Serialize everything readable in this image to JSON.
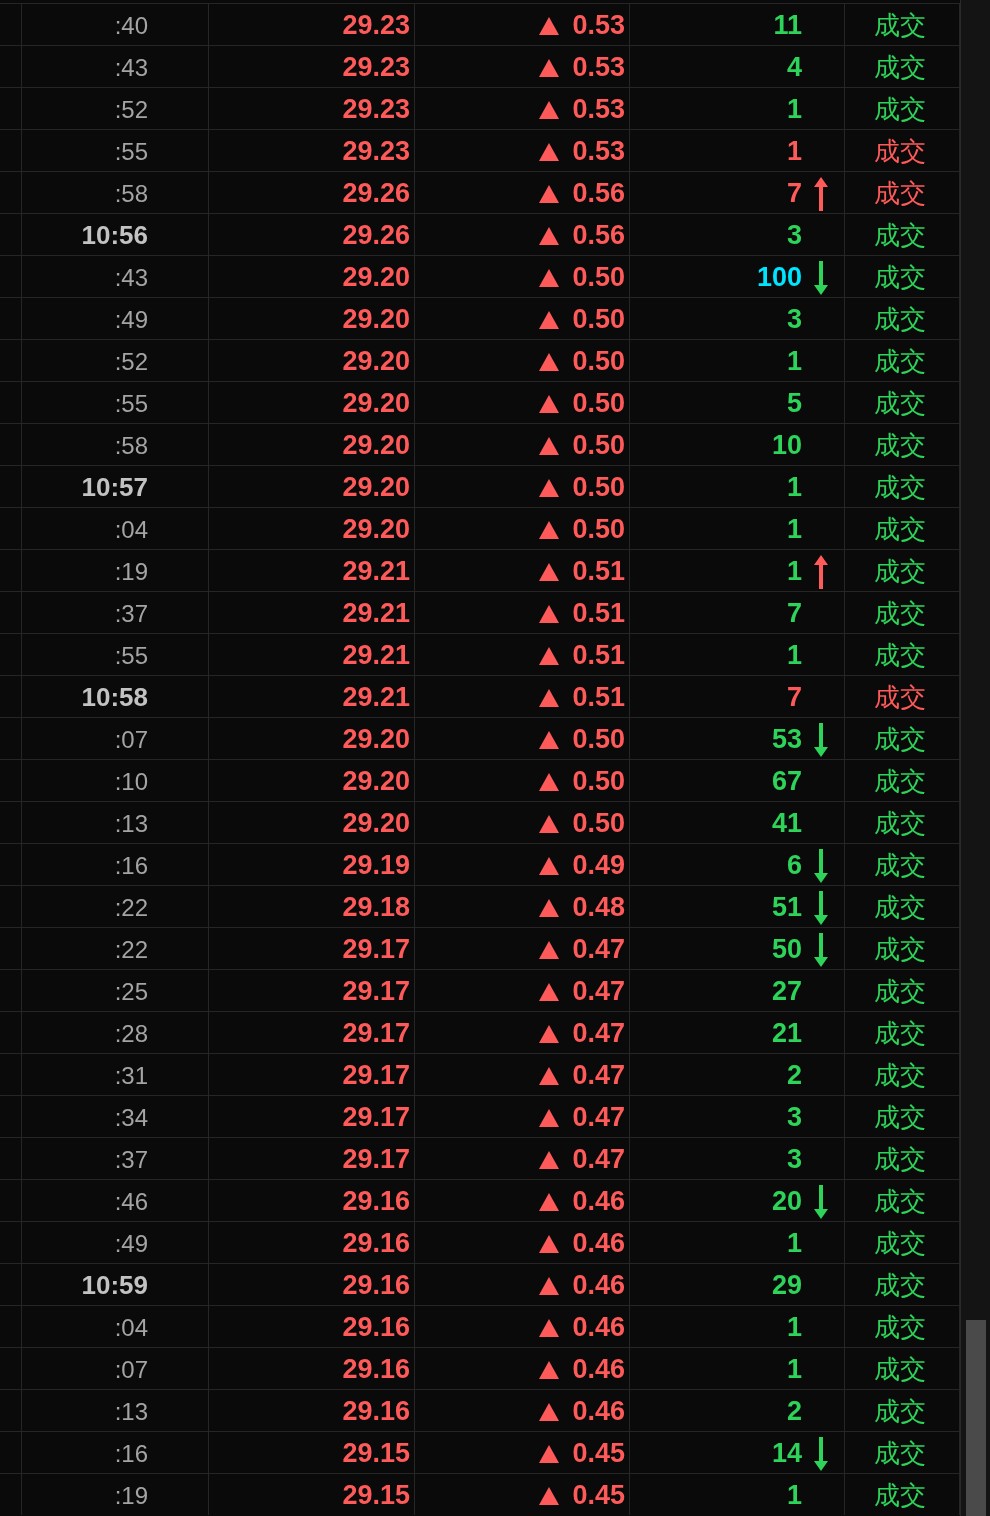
{
  "rows": [
    {
      "time": ":40",
      "bold": false,
      "price": "29.23",
      "change": {
        "text": "0.53",
        "rising": true
      },
      "volume": {
        "text": "11",
        "color": "#2ed35a"
      },
      "status": {
        "text": "成交",
        "color": "#2ed35a"
      }
    },
    {
      "time": ":43",
      "bold": false,
      "price": "29.23",
      "change": {
        "text": "0.53",
        "rising": true
      },
      "volume": {
        "text": "4",
        "color": "#2ed35a"
      },
      "status": {
        "text": "成交",
        "color": "#2ed35a"
      }
    },
    {
      "time": ":52",
      "bold": false,
      "price": "29.23",
      "change": {
        "text": "0.53",
        "rising": true
      },
      "volume": {
        "text": "1",
        "color": "#2ed35a"
      },
      "status": {
        "text": "成交",
        "color": "#2ed35a"
      }
    },
    {
      "time": ":55",
      "bold": false,
      "price": "29.23",
      "change": {
        "text": "0.53",
        "rising": true
      },
      "volume": {
        "text": "1",
        "color": "#ff5a5a"
      },
      "status": {
        "text": "成交",
        "color": "#ff5a5a"
      }
    },
    {
      "time": ":58",
      "bold": false,
      "price": "29.26",
      "change": {
        "text": "0.56",
        "rising": true
      },
      "volume": {
        "text": "7",
        "color": "#ff5a5a"
      },
      "arrow": {
        "kind": "up"
      },
      "status": {
        "text": "成交",
        "color": "#ff5a5a"
      }
    },
    {
      "time": "10:56",
      "bold": true,
      "price": "29.26",
      "change": {
        "text": "0.56",
        "rising": true
      },
      "volume": {
        "text": "3",
        "color": "#2ed35a"
      },
      "status": {
        "text": "成交",
        "color": "#2ed35a"
      }
    },
    {
      "time": ":43",
      "bold": false,
      "price": "29.20",
      "change": {
        "text": "0.50",
        "rising": true
      },
      "volume": {
        "text": "100",
        "color": "#00e5ff"
      },
      "arrow": {
        "kind": "down"
      },
      "status": {
        "text": "成交",
        "color": "#2ed35a"
      }
    },
    {
      "time": ":49",
      "bold": false,
      "price": "29.20",
      "change": {
        "text": "0.50",
        "rising": true
      },
      "volume": {
        "text": "3",
        "color": "#2ed35a"
      },
      "status": {
        "text": "成交",
        "color": "#2ed35a"
      }
    },
    {
      "time": ":52",
      "bold": false,
      "price": "29.20",
      "change": {
        "text": "0.50",
        "rising": true
      },
      "volume": {
        "text": "1",
        "color": "#2ed35a"
      },
      "status": {
        "text": "成交",
        "color": "#2ed35a"
      }
    },
    {
      "time": ":55",
      "bold": false,
      "price": "29.20",
      "change": {
        "text": "0.50",
        "rising": true
      },
      "volume": {
        "text": "5",
        "color": "#2ed35a"
      },
      "status": {
        "text": "成交",
        "color": "#2ed35a"
      }
    },
    {
      "time": ":58",
      "bold": false,
      "price": "29.20",
      "change": {
        "text": "0.50",
        "rising": true
      },
      "volume": {
        "text": "10",
        "color": "#2ed35a"
      },
      "status": {
        "text": "成交",
        "color": "#2ed35a"
      }
    },
    {
      "time": "10:57",
      "bold": true,
      "price": "29.20",
      "change": {
        "text": "0.50",
        "rising": true
      },
      "volume": {
        "text": "1",
        "color": "#2ed35a"
      },
      "status": {
        "text": "成交",
        "color": "#2ed35a"
      }
    },
    {
      "time": ":04",
      "bold": false,
      "price": "29.20",
      "change": {
        "text": "0.50",
        "rising": true
      },
      "volume": {
        "text": "1",
        "color": "#2ed35a"
      },
      "status": {
        "text": "成交",
        "color": "#2ed35a"
      }
    },
    {
      "time": ":19",
      "bold": false,
      "price": "29.21",
      "change": {
        "text": "0.51",
        "rising": true
      },
      "volume": {
        "text": "1",
        "color": "#2ed35a"
      },
      "arrow": {
        "kind": "up"
      },
      "status": {
        "text": "成交",
        "color": "#2ed35a"
      }
    },
    {
      "time": ":37",
      "bold": false,
      "price": "29.21",
      "change": {
        "text": "0.51",
        "rising": true
      },
      "volume": {
        "text": "7",
        "color": "#2ed35a"
      },
      "status": {
        "text": "成交",
        "color": "#2ed35a"
      }
    },
    {
      "time": ":55",
      "bold": false,
      "price": "29.21",
      "change": {
        "text": "0.51",
        "rising": true
      },
      "volume": {
        "text": "1",
        "color": "#2ed35a"
      },
      "status": {
        "text": "成交",
        "color": "#2ed35a"
      }
    },
    {
      "time": "10:58",
      "bold": true,
      "price": "29.21",
      "change": {
        "text": "0.51",
        "rising": true
      },
      "volume": {
        "text": "7",
        "color": "#ff5a5a"
      },
      "status": {
        "text": "成交",
        "color": "#ff5a5a"
      }
    },
    {
      "time": ":07",
      "bold": false,
      "price": "29.20",
      "change": {
        "text": "0.50",
        "rising": true
      },
      "volume": {
        "text": "53",
        "color": "#2ed35a"
      },
      "arrow": {
        "kind": "down"
      },
      "status": {
        "text": "成交",
        "color": "#2ed35a"
      }
    },
    {
      "time": ":10",
      "bold": false,
      "price": "29.20",
      "change": {
        "text": "0.50",
        "rising": true
      },
      "volume": {
        "text": "67",
        "color": "#2ed35a"
      },
      "status": {
        "text": "成交",
        "color": "#2ed35a"
      }
    },
    {
      "time": ":13",
      "bold": false,
      "price": "29.20",
      "change": {
        "text": "0.50",
        "rising": true
      },
      "volume": {
        "text": "41",
        "color": "#2ed35a"
      },
      "status": {
        "text": "成交",
        "color": "#2ed35a"
      }
    },
    {
      "time": ":16",
      "bold": false,
      "price": "29.19",
      "change": {
        "text": "0.49",
        "rising": true
      },
      "volume": {
        "text": "6",
        "color": "#2ed35a"
      },
      "arrow": {
        "kind": "down"
      },
      "status": {
        "text": "成交",
        "color": "#2ed35a"
      }
    },
    {
      "time": ":22",
      "bold": false,
      "price": "29.18",
      "change": {
        "text": "0.48",
        "rising": true
      },
      "volume": {
        "text": "51",
        "color": "#2ed35a"
      },
      "arrow": {
        "kind": "down"
      },
      "status": {
        "text": "成交",
        "color": "#2ed35a"
      }
    },
    {
      "time": ":22",
      "bold": false,
      "price": "29.17",
      "change": {
        "text": "0.47",
        "rising": true
      },
      "volume": {
        "text": "50",
        "color": "#2ed35a"
      },
      "arrow": {
        "kind": "down"
      },
      "status": {
        "text": "成交",
        "color": "#2ed35a"
      }
    },
    {
      "time": ":25",
      "bold": false,
      "price": "29.17",
      "change": {
        "text": "0.47",
        "rising": true
      },
      "volume": {
        "text": "27",
        "color": "#2ed35a"
      },
      "status": {
        "text": "成交",
        "color": "#2ed35a"
      }
    },
    {
      "time": ":28",
      "bold": false,
      "price": "29.17",
      "change": {
        "text": "0.47",
        "rising": true
      },
      "volume": {
        "text": "21",
        "color": "#2ed35a"
      },
      "status": {
        "text": "成交",
        "color": "#2ed35a"
      }
    },
    {
      "time": ":31",
      "bold": false,
      "price": "29.17",
      "change": {
        "text": "0.47",
        "rising": true
      },
      "volume": {
        "text": "2",
        "color": "#2ed35a"
      },
      "status": {
        "text": "成交",
        "color": "#2ed35a"
      }
    },
    {
      "time": ":34",
      "bold": false,
      "price": "29.17",
      "change": {
        "text": "0.47",
        "rising": true
      },
      "volume": {
        "text": "3",
        "color": "#2ed35a"
      },
      "status": {
        "text": "成交",
        "color": "#2ed35a"
      }
    },
    {
      "time": ":37",
      "bold": false,
      "price": "29.17",
      "change": {
        "text": "0.47",
        "rising": true
      },
      "volume": {
        "text": "3",
        "color": "#2ed35a"
      },
      "status": {
        "text": "成交",
        "color": "#2ed35a"
      }
    },
    {
      "time": ":46",
      "bold": false,
      "price": "29.16",
      "change": {
        "text": "0.46",
        "rising": true
      },
      "volume": {
        "text": "20",
        "color": "#2ed35a"
      },
      "arrow": {
        "kind": "down"
      },
      "status": {
        "text": "成交",
        "color": "#2ed35a"
      }
    },
    {
      "time": ":49",
      "bold": false,
      "price": "29.16",
      "change": {
        "text": "0.46",
        "rising": true
      },
      "volume": {
        "text": "1",
        "color": "#2ed35a"
      },
      "status": {
        "text": "成交",
        "color": "#2ed35a"
      }
    },
    {
      "time": "10:59",
      "bold": true,
      "price": "29.16",
      "change": {
        "text": "0.46",
        "rising": true
      },
      "volume": {
        "text": "29",
        "color": "#2ed35a"
      },
      "status": {
        "text": "成交",
        "color": "#2ed35a"
      }
    },
    {
      "time": ":04",
      "bold": false,
      "price": "29.16",
      "change": {
        "text": "0.46",
        "rising": true
      },
      "volume": {
        "text": "1",
        "color": "#2ed35a"
      },
      "status": {
        "text": "成交",
        "color": "#2ed35a"
      }
    },
    {
      "time": ":07",
      "bold": false,
      "price": "29.16",
      "change": {
        "text": "0.46",
        "rising": true
      },
      "volume": {
        "text": "1",
        "color": "#2ed35a"
      },
      "status": {
        "text": "成交",
        "color": "#2ed35a"
      }
    },
    {
      "time": ":13",
      "bold": false,
      "price": "29.16",
      "change": {
        "text": "0.46",
        "rising": true
      },
      "volume": {
        "text": "2",
        "color": "#2ed35a"
      },
      "status": {
        "text": "成交",
        "color": "#2ed35a"
      }
    },
    {
      "time": ":16",
      "bold": false,
      "price": "29.15",
      "change": {
        "text": "0.45",
        "rising": true
      },
      "volume": {
        "text": "14",
        "color": "#2ed35a"
      },
      "arrow": {
        "kind": "down"
      },
      "status": {
        "text": "成交",
        "color": "#2ed35a"
      }
    },
    {
      "time": ":19",
      "bold": false,
      "price": "29.15",
      "change": {
        "text": "0.45",
        "rising": true
      },
      "volume": {
        "text": "1",
        "color": "#2ed35a"
      },
      "status": {
        "text": "成交",
        "color": "#2ed35a"
      }
    }
  ]
}
